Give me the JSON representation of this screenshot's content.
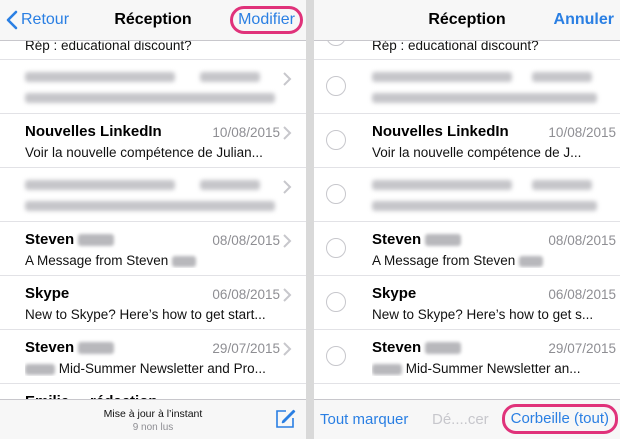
{
  "left": {
    "nav": {
      "back_label": "Retour",
      "title": "Réception",
      "edit_label": "Modifier"
    },
    "partial_subject": "Rép : educational discount?",
    "rows": [
      {
        "sender": "Nouvelles LinkedIn",
        "date": "10/08/2015",
        "preview": "Voir la nouvelle compétence de Julian..."
      },
      {
        "sender": "Steven",
        "date": "08/08/2015",
        "preview": "A Message from Steven"
      },
      {
        "sender": "Skype",
        "date": "06/08/2015",
        "preview": "New to Skype? Here’s how to get start..."
      },
      {
        "sender": "Steven",
        "date": "29/07/2015",
        "preview": "Mid-Summer Newsletter and Pro..."
      },
      {
        "sender": "Emilie ... rédaction"
      }
    ],
    "toolbar": {
      "status": "Mise à jour à l’instant",
      "unread": "9 non lus"
    },
    "icons": {
      "back": "chevron-left-icon",
      "compose": "compose-icon",
      "disclosure": "chevron-right-icon"
    }
  },
  "right": {
    "nav": {
      "title": "Réception",
      "cancel_label": "Annuler"
    },
    "partial_subject": "Rép : educational discount?",
    "rows": [
      {
        "sender": "Nouvelles LinkedIn",
        "date": "10/08/2015",
        "preview": "Voir la nouvelle compétence de J..."
      },
      {
        "sender": "Steven",
        "date": "08/08/2015",
        "preview": "A Message from Steven"
      },
      {
        "sender": "Skype",
        "date": "06/08/2015",
        "preview": "New to Skype? Here’s how to get s..."
      },
      {
        "sender": "Steven",
        "date": "29/07/2015",
        "preview": "Mid-Summer Newsletter an..."
      }
    ],
    "toolbar": {
      "mark_all": "Tout marquer",
      "move": "Dé....cer",
      "trash_all": "Corbeille (tout)"
    }
  },
  "colors": {
    "accent": "#2a7fe3",
    "highlight": "#e0327a"
  }
}
